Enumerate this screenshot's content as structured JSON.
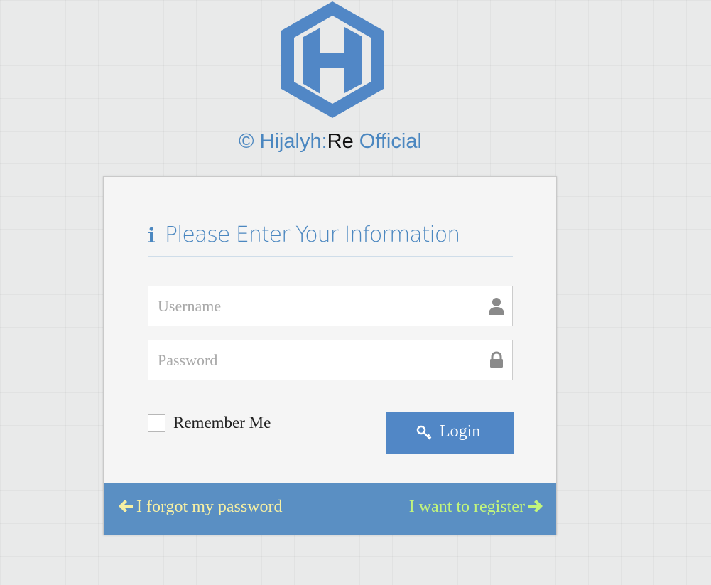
{
  "brand": {
    "logo_icon": "hexagon-h-logo",
    "copyright": "©",
    "name_part1": "Hijalyh:",
    "name_part2": "Re",
    "name_part3": "Official",
    "color_primary": "#4b87c0"
  },
  "form": {
    "title_icon": "info-icon",
    "info_glyph": "i",
    "title": "Please Enter Your Information",
    "username": {
      "value": "",
      "placeholder": "Username",
      "icon": "user-icon"
    },
    "password": {
      "value": "",
      "placeholder": "Password",
      "icon": "lock-icon"
    },
    "remember_label": "Remember Me",
    "remember_checked": false,
    "login_label": "Login",
    "login_icon": "key-icon",
    "login_color": "#5187c6"
  },
  "footer": {
    "forgot_label": "I forgot my password",
    "forgot_color": "#f7f0a3",
    "register_label": "I want to register",
    "register_color": "#c2f57c",
    "background": "#5a8fc3"
  }
}
